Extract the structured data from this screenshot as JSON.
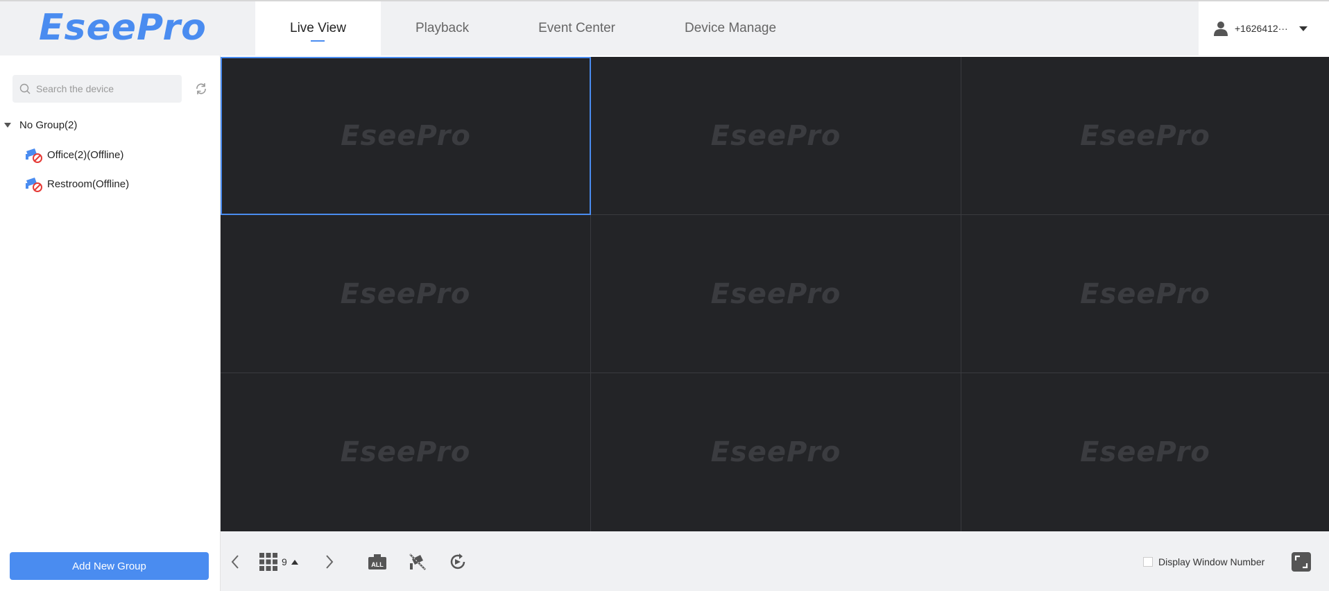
{
  "app": {
    "logo": "EseePro"
  },
  "tabs": [
    {
      "label": "Live View",
      "active": true
    },
    {
      "label": "Playback",
      "active": false
    },
    {
      "label": "Event Center",
      "active": false
    },
    {
      "label": "Device Manage",
      "active": false
    }
  ],
  "user": {
    "name": "+1626412···"
  },
  "sidebar": {
    "search_placeholder": "Search the device",
    "group": {
      "label": "No Group(2)"
    },
    "devices": [
      {
        "label": "Office(2)(Offline)"
      },
      {
        "label": "Restroom(Offline)"
      }
    ],
    "add_group_label": "Add New Group"
  },
  "grid": {
    "layout_count": "9",
    "watermark": "EseePro"
  },
  "bottombar": {
    "display_window_number_label": "Display Window Number",
    "display_window_number_checked": false
  },
  "colors": {
    "accent": "#4a8cf0",
    "video_bg": "#232427",
    "offline_badge": "#e53935"
  }
}
